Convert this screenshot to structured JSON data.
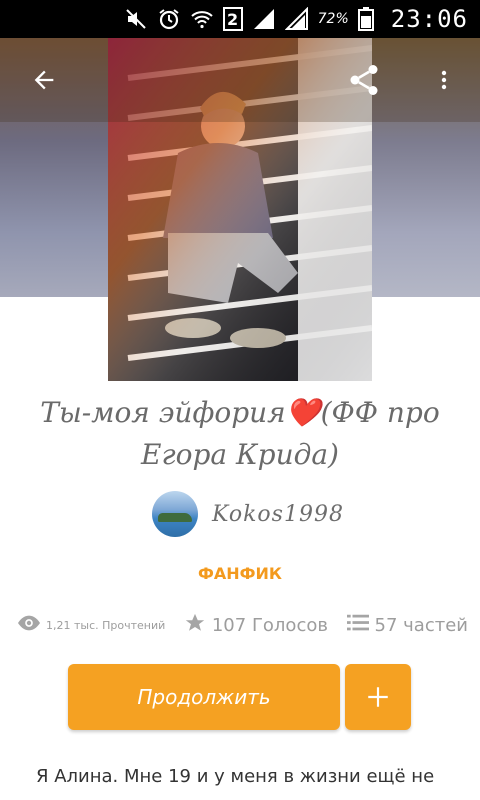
{
  "status_bar": {
    "sim_number": "2",
    "battery_percent": "72%",
    "time": "23:06",
    "icons": [
      "mute-icon",
      "alarm-icon",
      "wifi-icon",
      "sim-icon",
      "signal-icon",
      "signal-icon",
      "battery-icon"
    ]
  },
  "toolbar": {
    "back_icon": "back-arrow-icon",
    "share_icon": "share-icon",
    "more_icon": "more-vertical-icon"
  },
  "story": {
    "title": "Ты-моя эйфория❤️(ФФ про Егора Крида)",
    "author": "Kokos1998",
    "category": "ФАНФИК"
  },
  "stats": {
    "reads": "1,21 тыс. Прочтений",
    "votes": "107 Голосов",
    "parts": "57 частей"
  },
  "actions": {
    "continue_label": "Продолжить",
    "add_label": "+"
  },
  "description": {
    "text": "Я Алина. Мне 19 и у меня в жизни ещё не"
  },
  "colors": {
    "accent": "#f5a122",
    "category": "#f39a1e",
    "muted_text": "#9d9d9d"
  }
}
